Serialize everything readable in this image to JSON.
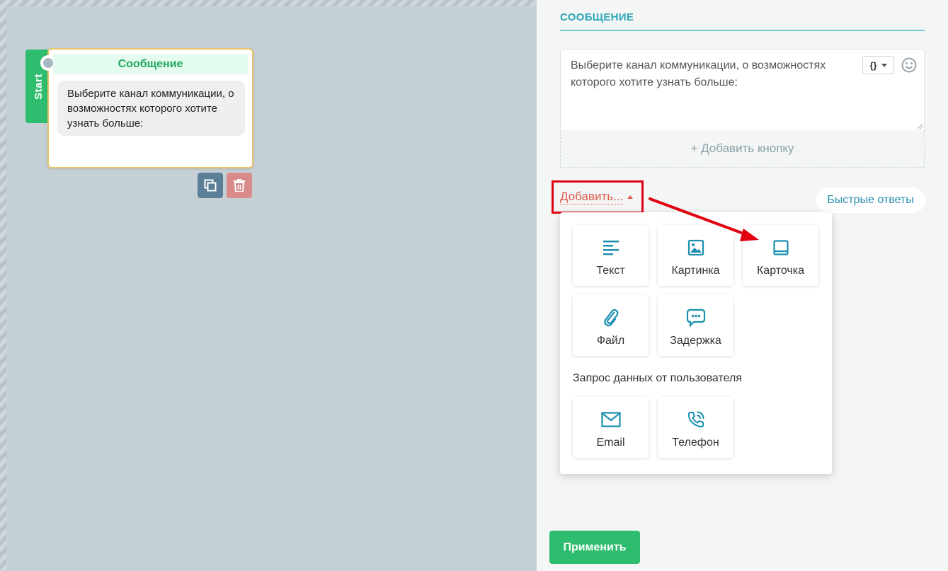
{
  "canvas": {
    "start_label": "Start",
    "node": {
      "title": "Сообщение",
      "text": "Выберите канал коммуникации, о возможностях которого хотите узнать больше:"
    }
  },
  "panel": {
    "title": "СООБЩЕНИЕ",
    "message_text": "Выберите канал коммуникации, о возможностях которого хотите узнать больше:",
    "variable_button_label": "{}",
    "add_button_label": "+ Добавить кнопку",
    "add_dropdown_label": "Добавить...",
    "quick_replies_label": "Быстрые ответы",
    "apply_label": "Применить"
  },
  "menu": {
    "items": [
      {
        "label": "Текст",
        "icon": "text-lines-icon"
      },
      {
        "label": "Картинка",
        "icon": "image-icon"
      },
      {
        "label": "Карточка",
        "icon": "card-icon"
      },
      {
        "label": "Файл",
        "icon": "paperclip-icon"
      },
      {
        "label": "Задержка",
        "icon": "typing-bubble-icon"
      }
    ],
    "section_label": "Запрос данных от пользователя",
    "input_items": [
      {
        "label": "Email",
        "icon": "envelope-icon"
      },
      {
        "label": "Телефон",
        "icon": "phone-icon"
      }
    ]
  },
  "colors": {
    "accent_green": "#2ebd6e",
    "accent_teal": "#2aa6b9",
    "icon_teal": "#1a8fb0",
    "highlight_red": "#e0000f"
  }
}
